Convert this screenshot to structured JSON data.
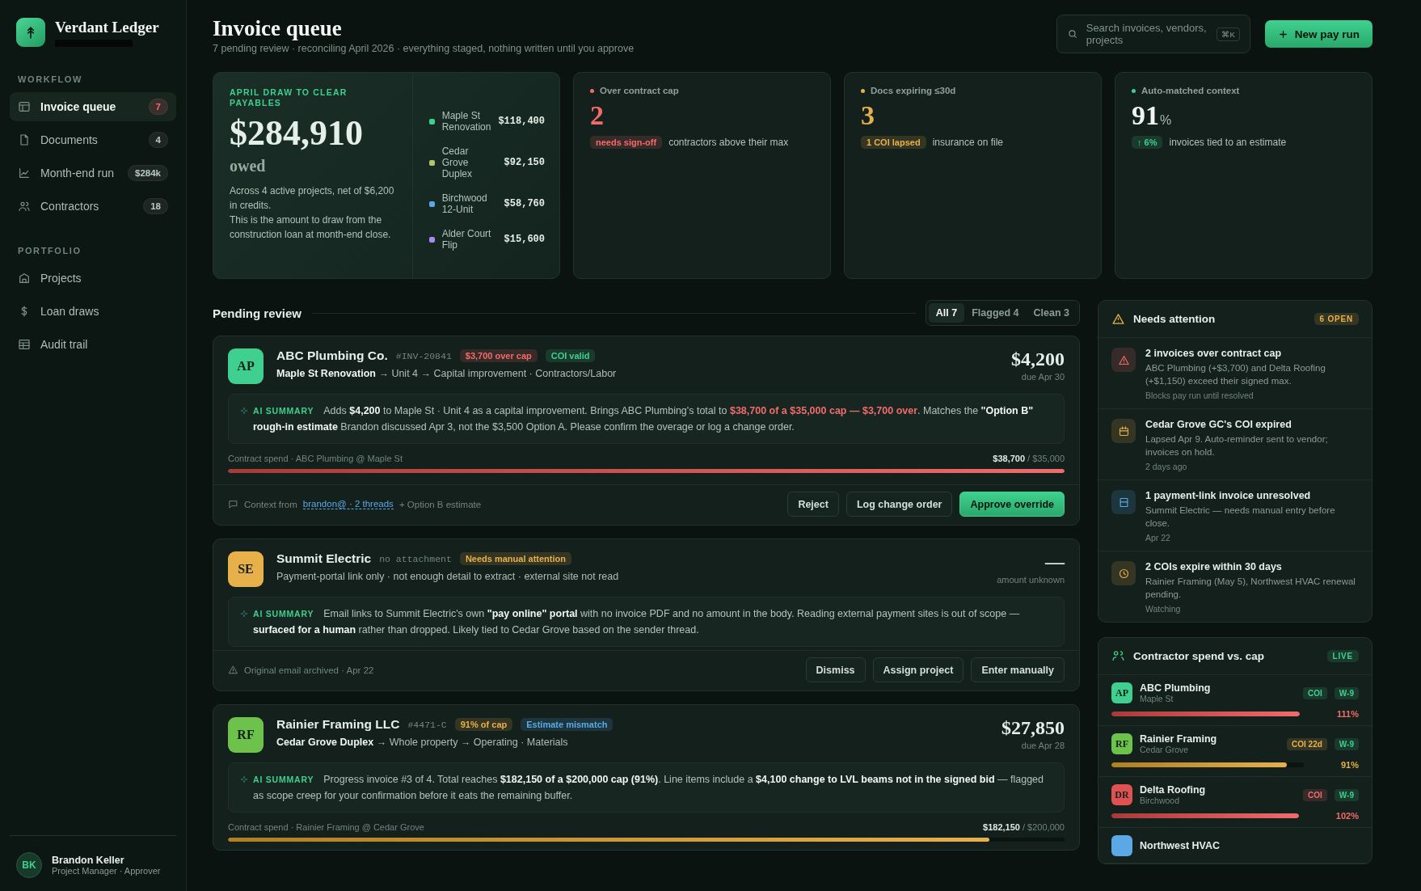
{
  "brand": {
    "name": "Verdant Ledger"
  },
  "sidebar": {
    "sections": [
      {
        "heading": "WORKFLOW",
        "items": [
          {
            "label": "Invoice queue",
            "kind": "table",
            "badge": "7",
            "alert": true,
            "selected": true
          },
          {
            "label": "Documents",
            "kind": "file",
            "badge": "4",
            "alert": false,
            "selected": false
          },
          {
            "label": "Month-end run",
            "kind": "chart",
            "badge": "$284k",
            "alert": false,
            "selected": false
          },
          {
            "label": "Contractors",
            "kind": "users",
            "badge": "18",
            "alert": false,
            "selected": false
          }
        ]
      },
      {
        "heading": "PORTFOLIO",
        "items": [
          {
            "label": "Projects",
            "kind": "building",
            "selected": false
          },
          {
            "label": "Loan draws",
            "kind": "dollar",
            "selected": false
          },
          {
            "label": "Audit trail",
            "kind": "layout",
            "selected": false
          }
        ]
      }
    ]
  },
  "user": {
    "initials": "BK",
    "name": "Brandon Keller",
    "role": "Project Manager · Approver"
  },
  "header": {
    "title": "Invoice queue",
    "subtitle": "7 pending review · reconciling April 2026 · everything staged, nothing written until you approve",
    "search": {
      "placeholder": "Search invoices, vendors, projects",
      "shortcut": "⌘K"
    },
    "action": "New pay run"
  },
  "draw": {
    "eyebrow": "APRIL DRAW TO CLEAR PAYABLES",
    "amount": "$284,910",
    "suffix": "owed",
    "notes": [
      "Across 4 active projects, net of $6,200 in credits.",
      "This is the amount to draw from the construction loan at month-end close."
    ],
    "projects": [
      {
        "name": "Maple St Renovation",
        "amount": "$118,400",
        "color": "#3fcf8e"
      },
      {
        "name": "Cedar Grove Duplex",
        "amount": "$92,150",
        "color": "#b5c46a"
      },
      {
        "name": "Birchwood 12-Unit",
        "amount": "$58,760",
        "color": "#5aa9e6"
      },
      {
        "name": "Alder Court Flip",
        "amount": "$15,600",
        "color": "#a98bf0"
      }
    ]
  },
  "stats": [
    {
      "label": "Over contract cap",
      "kind": "danger",
      "value": "2",
      "badge": "needs sign-off",
      "text": "contractors above their max"
    },
    {
      "label": "Docs expiring ≤30d",
      "kind": "warning",
      "value": "3",
      "badge": "1 COI lapsed",
      "text": "insurance on file"
    },
    {
      "label": "Auto-matched context",
      "kind": "success",
      "value": "91",
      "unit": "%",
      "badge": "↑ 6%",
      "text": "invoices tied to an estimate"
    }
  ],
  "pending": {
    "title": "Pending review",
    "filters": [
      {
        "label": "All 7",
        "selected": true
      },
      {
        "label": "Flagged 4",
        "selected": false
      },
      {
        "label": "Clean 3",
        "selected": false
      }
    ]
  },
  "invoices": [
    {
      "initials": "AP",
      "color": "#3fcf8e",
      "vendor": "ABC Plumbing Co.",
      "ref": "#INV-20841",
      "tags": [
        {
          "text": "$3,700 over cap",
          "kind": "danger"
        },
        {
          "text": "COI valid",
          "kind": "success"
        }
      ],
      "route": "**Maple St Renovation** → Unit 4 → Capital improvement · Contractors/Labor",
      "amount": "$4,200",
      "due": "due Apr 30",
      "summary_label": "AI SUMMARY",
      "summary": [
        {
          "text": "Adds ",
          "kind": "plain"
        },
        {
          "text": "$4,200",
          "kind": "bold"
        },
        {
          "text": " to Maple St · Unit 4 as a capital improvement. Brings ABC Plumbing's total to ",
          "kind": "plain"
        },
        {
          "text": "$38,700 of a $35,000 cap — $3,700 over",
          "kind": "alert"
        },
        {
          "text": ". Matches the ",
          "kind": "plain"
        },
        {
          "text": "\"Option B\" rough-in estimate",
          "kind": "bold"
        },
        {
          "text": " Brandon discussed Apr 3, not the $3,500 Option A. Please confirm the overage or log a change order.",
          "kind": "plain"
        }
      ],
      "spend": {
        "label": "Contract spend · ABC Plumbing @ Maple St",
        "amount": "**$38,700** / $35,000",
        "level": 1,
        "kind": "danger"
      },
      "footer": {
        "kind": "chat",
        "text": "Context from",
        "link": "brandon@ · 2 threads",
        "extra": "+ Option B estimate"
      },
      "actions": [
        {
          "label": "Reject",
          "kind": "secondary"
        },
        {
          "label": "Log change order",
          "kind": "secondary"
        },
        {
          "label": "Approve override",
          "kind": "primary"
        }
      ]
    },
    {
      "initials": "SE",
      "color": "#e8b04a",
      "vendor": "Summit Electric",
      "ref": "no attachment",
      "tags": [
        {
          "text": "Needs manual attention",
          "kind": "warning"
        }
      ],
      "route": "Payment-portal link only · not enough detail to extract · external site not read",
      "amount": "—",
      "due": "amount unknown",
      "summary_label": "AI SUMMARY",
      "summary": [
        {
          "text": "Email links to Summit Electric's own ",
          "kind": "plain"
        },
        {
          "text": "\"pay online\" portal",
          "kind": "bold"
        },
        {
          "text": " with no invoice PDF and no amount in the body. Reading external payment sites is out of scope — ",
          "kind": "plain"
        },
        {
          "text": "surfaced for a human",
          "kind": "bold"
        },
        {
          "text": " rather than dropped. Likely tied to Cedar Grove based on the sender thread.",
          "kind": "plain"
        }
      ],
      "footer": {
        "kind": "warning",
        "text": "Original email archived · Apr 22"
      },
      "actions": [
        {
          "label": "Dismiss",
          "kind": "secondary"
        },
        {
          "label": "Assign project",
          "kind": "secondary"
        },
        {
          "label": "Enter manually",
          "kind": "secondary"
        }
      ]
    },
    {
      "initials": "RF",
      "color": "#6cc24a",
      "vendor": "Rainier Framing LLC",
      "ref": "#4471-C",
      "tags": [
        {
          "text": "91% of cap",
          "kind": "warning"
        },
        {
          "text": "Estimate mismatch",
          "kind": "info"
        }
      ],
      "route": "**Cedar Grove Duplex** → Whole property → Operating · Materials",
      "amount": "$27,850",
      "due": "due Apr 28",
      "summary_label": "AI SUMMARY",
      "summary": [
        {
          "text": "Progress invoice #3 of 4. Total reaches ",
          "kind": "plain"
        },
        {
          "text": "$182,150 of a $200,000 cap (91%)",
          "kind": "bold"
        },
        {
          "text": ". Line items include a ",
          "kind": "plain"
        },
        {
          "text": "$4,100 change to LVL beams not in the signed bid",
          "kind": "bold"
        },
        {
          "text": " — flagged as scope creep for your confirmation before it eats the remaining buffer.",
          "kind": "plain"
        }
      ],
      "spend": {
        "label": "Contract spend · Rainier Framing @ Cedar Grove",
        "amount": "**$182,150** / $200,000",
        "level": 0.91,
        "kind": "warning"
      }
    }
  ],
  "attention": {
    "title": "Needs attention",
    "badge": "6 OPEN",
    "items": [
      {
        "kind": "alert",
        "title": "2 invoices over contract cap",
        "text": "ABC Plumbing (+$3,700) and Delta Roofing (+$1,150) exceed their signed max.",
        "meta": "Blocks pay run until resolved"
      },
      {
        "kind": "calendar",
        "title": "Cedar Grove GC's COI expired",
        "text": "Lapsed Apr 9. Auto-reminder sent to vendor; invoices on hold.",
        "meta": "2 days ago"
      },
      {
        "kind": "card",
        "title": "1 payment-link invoice unresolved",
        "text": "Summit Electric — needs manual entry before close.",
        "meta": "Apr 22"
      },
      {
        "kind": "clock",
        "title": "2 COIs expire within 30 days",
        "text": "Rainier Framing (May 5), Northwest HVAC renewal pending.",
        "meta": "Watching"
      }
    ]
  },
  "contractors": {
    "title": "Contractor spend vs. cap",
    "badge": "LIVE",
    "rows": [
      {
        "initials": "AP",
        "color": "#3fcf8e",
        "name": "ABC Plumbing",
        "project": "Maple St",
        "docs": [
          {
            "text": "COI",
            "kind": "success"
          },
          {
            "text": "W-9",
            "kind": "success"
          }
        ],
        "level": 1,
        "kind": "danger",
        "pct": "111%"
      },
      {
        "initials": "RF",
        "color": "#6cc24a",
        "name": "Rainier Framing",
        "project": "Cedar Grove",
        "docs": [
          {
            "text": "COI 22d",
            "kind": "warning"
          },
          {
            "text": "W-9",
            "kind": "success"
          }
        ],
        "level": 0.91,
        "kind": "warning",
        "pct": "91%"
      },
      {
        "initials": "DR",
        "color": "#e05252",
        "name": "Delta Roofing",
        "project": "Birchwood",
        "docs": [
          {
            "text": "COI",
            "kind": "danger"
          },
          {
            "text": "W-9",
            "kind": "success"
          }
        ],
        "level": 1,
        "kind": "danger",
        "pct": "102%"
      },
      {
        "color": "#5aa9e6",
        "name": "Northwest HVAC"
      }
    ]
  }
}
